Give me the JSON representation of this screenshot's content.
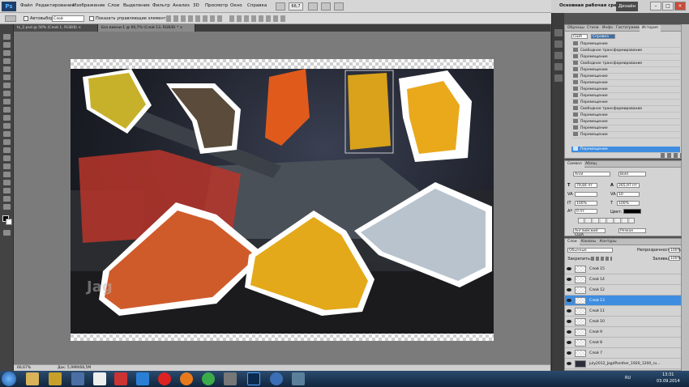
{
  "app": {
    "logo_text": "Ps"
  },
  "menu": [
    "Файл",
    "Редактирование",
    "Изображение",
    "Слои",
    "Выделение",
    "Фильтр",
    "Анализ",
    "3D",
    "Просмотр",
    "Окно",
    "Справка"
  ],
  "zoom_combo": "66,7",
  "workspace": {
    "label": "Основная рабочая среда",
    "design_button": "Дизайн"
  },
  "options": {
    "autoselect_label": "Автовыбор:",
    "autoselect_value": "Слой",
    "transform_controls_label": "Показать управляющие элементы"
  },
  "tabs": [
    {
      "label": "ts_2.psd @ 50% (Слой 1, RGB/8) ×",
      "active": false
    },
    {
      "label": "Без имени-1 @ 66,7% (Слой 13, RGB/8) * ×",
      "active": true
    }
  ],
  "status": {
    "zoom": "66,67%",
    "doc": "Док: 5,99M/68,5M"
  },
  "history": {
    "tabs": [
      "Образцы",
      "Стили",
      "Инфо",
      "Гистограмма",
      "История"
    ],
    "active_tab": "История",
    "items": [
      "Перемещение",
      "Свободное трансформирование",
      "Перемещение",
      "Свободное трансформирование",
      "Перемещение",
      "Перемещение",
      "Перемещение",
      "Перемещение",
      "Перемещение",
      "Перемещение",
      "Свободное трансформирование",
      "Перемещение",
      "Перемещение",
      "Перемещение",
      "Перемещение",
      "Перемещение"
    ],
    "selected": "Перемещение",
    "top_fields": [
      "США",
      "Справка"
    ]
  },
  "character": {
    "tabs": [
      "Символ",
      "Абзац"
    ],
    "font": "Arial",
    "style": "Bold",
    "size": "79,84 пт",
    "leading": "265,97 пт",
    "kerning": "",
    "tracking": "10",
    "vscale": "100%",
    "hscale": "100%",
    "baseline": "0 пт",
    "color_label": "Цвет:",
    "language": "Английский: США",
    "antialias": "Резкое"
  },
  "layers": {
    "tabs": [
      "Слои",
      "Каналы",
      "Контуры"
    ],
    "blend_mode": "Обычные",
    "opacity_label": "Непрозрачность:",
    "opacity": "100%",
    "lock_label": "Закрепить:",
    "fill_label": "Заливка:",
    "fill": "100%",
    "items": [
      "Слой 15",
      "Слой 14",
      "Слой 12",
      "Слой 13",
      "Слой 11",
      "Слой 10",
      "Слой 9",
      "Слой 8",
      "Слой 7",
      "july2012_JagdPanther_1920_1200_ru..."
    ],
    "selected": "Слой 13"
  },
  "taskbar": {
    "time": "13:31",
    "date": "03.09.2014",
    "language": "RU"
  },
  "colors": {
    "accent": "#3f8de0",
    "panel": "#d3d3d3",
    "canvas_bg": "#7b7b7b"
  }
}
